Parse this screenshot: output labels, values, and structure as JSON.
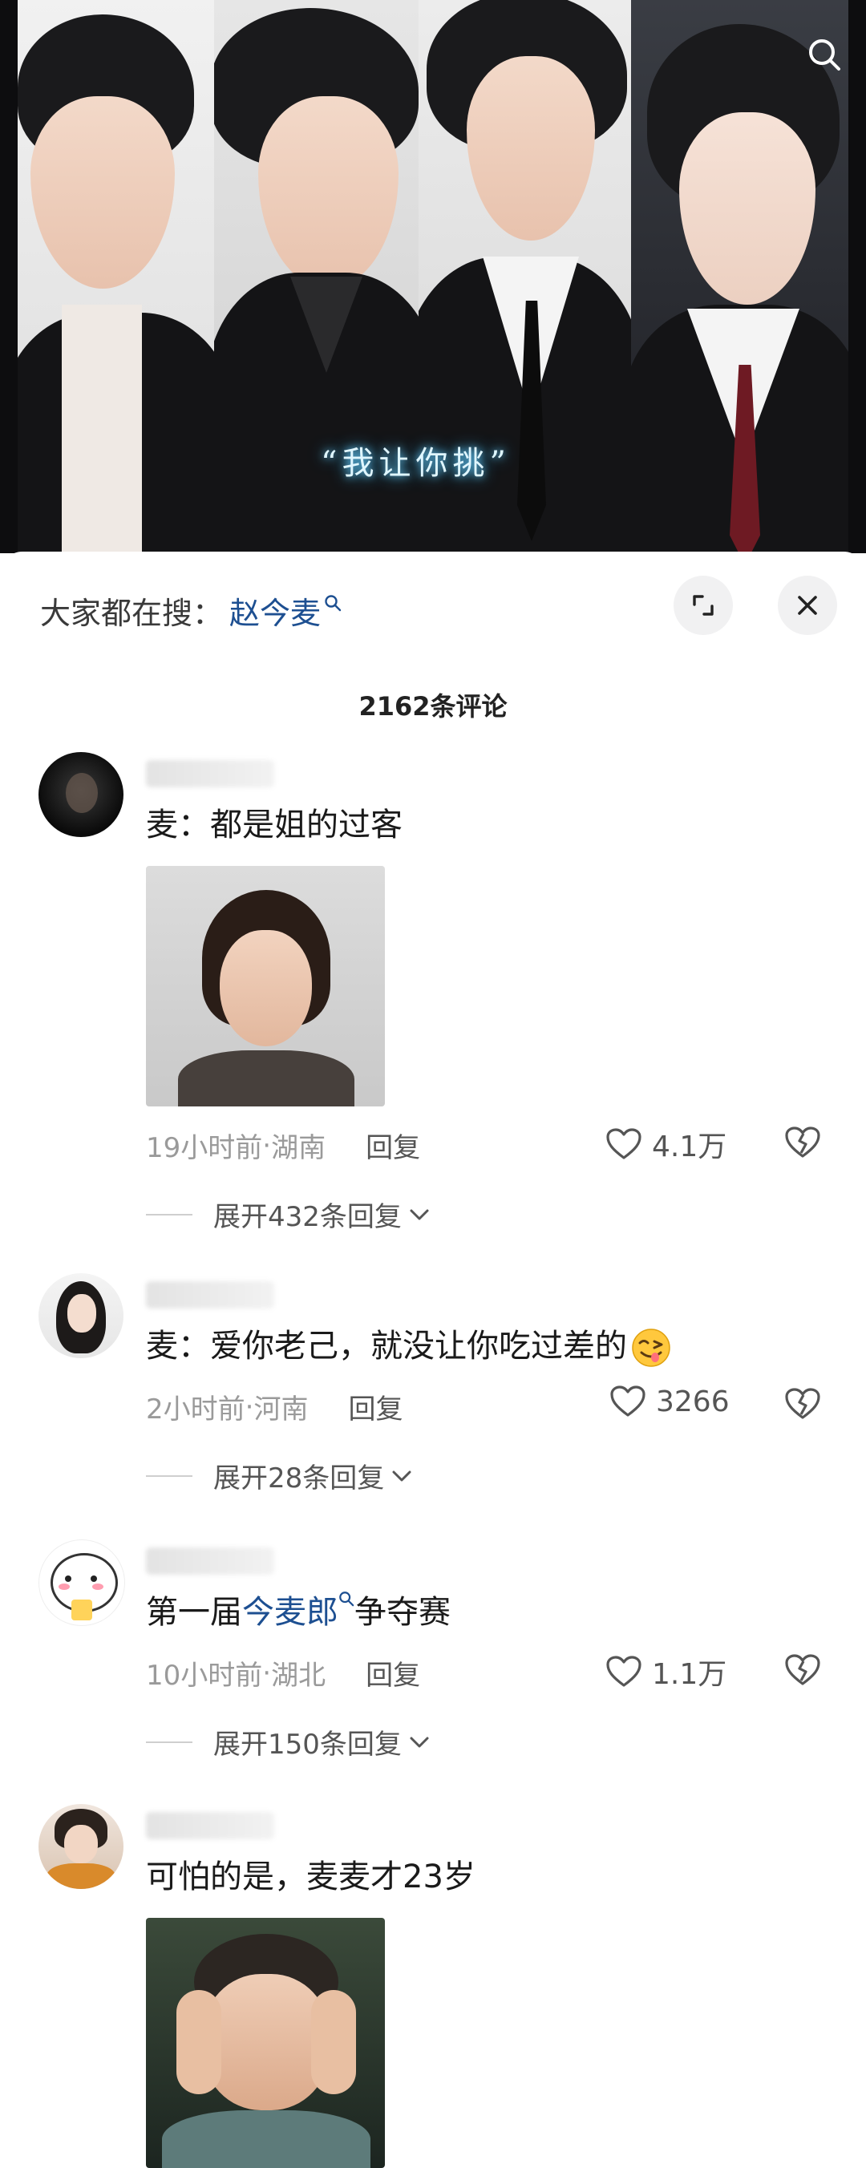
{
  "video": {
    "caption": "“我让你挑”"
  },
  "search": {
    "prefix": "大家都在搜：",
    "term": "赵今麦"
  },
  "comments_header": {
    "count_label": "2162条评论"
  },
  "comments": [
    {
      "text": "麦：都是姐的过客",
      "time": "19小时前",
      "location": "湖南",
      "reply_label": "回复",
      "likes": "4.1万",
      "expand_label": "展开432条回复"
    },
    {
      "text": "麦：爱你老己，就没让你吃过差的",
      "emoji_icon": "yum-face-icon",
      "time": "2小时前",
      "location": "河南",
      "reply_label": "回复",
      "likes": "3266",
      "expand_label": "展开28条回复"
    },
    {
      "text_before": "第一届",
      "text_link": "今麦郎",
      "text_after": "争夺赛",
      "time": "10小时前",
      "location": "湖北",
      "reply_label": "回复",
      "likes": "1.1万",
      "expand_label": "展开150条回复"
    },
    {
      "text": "可怕的是，麦麦才23岁"
    }
  ],
  "meta_separator": " · ",
  "colors": {
    "link": "#1d4f91",
    "muted": "#9a9a9a",
    "caption_glow": "#6fd2ff"
  }
}
